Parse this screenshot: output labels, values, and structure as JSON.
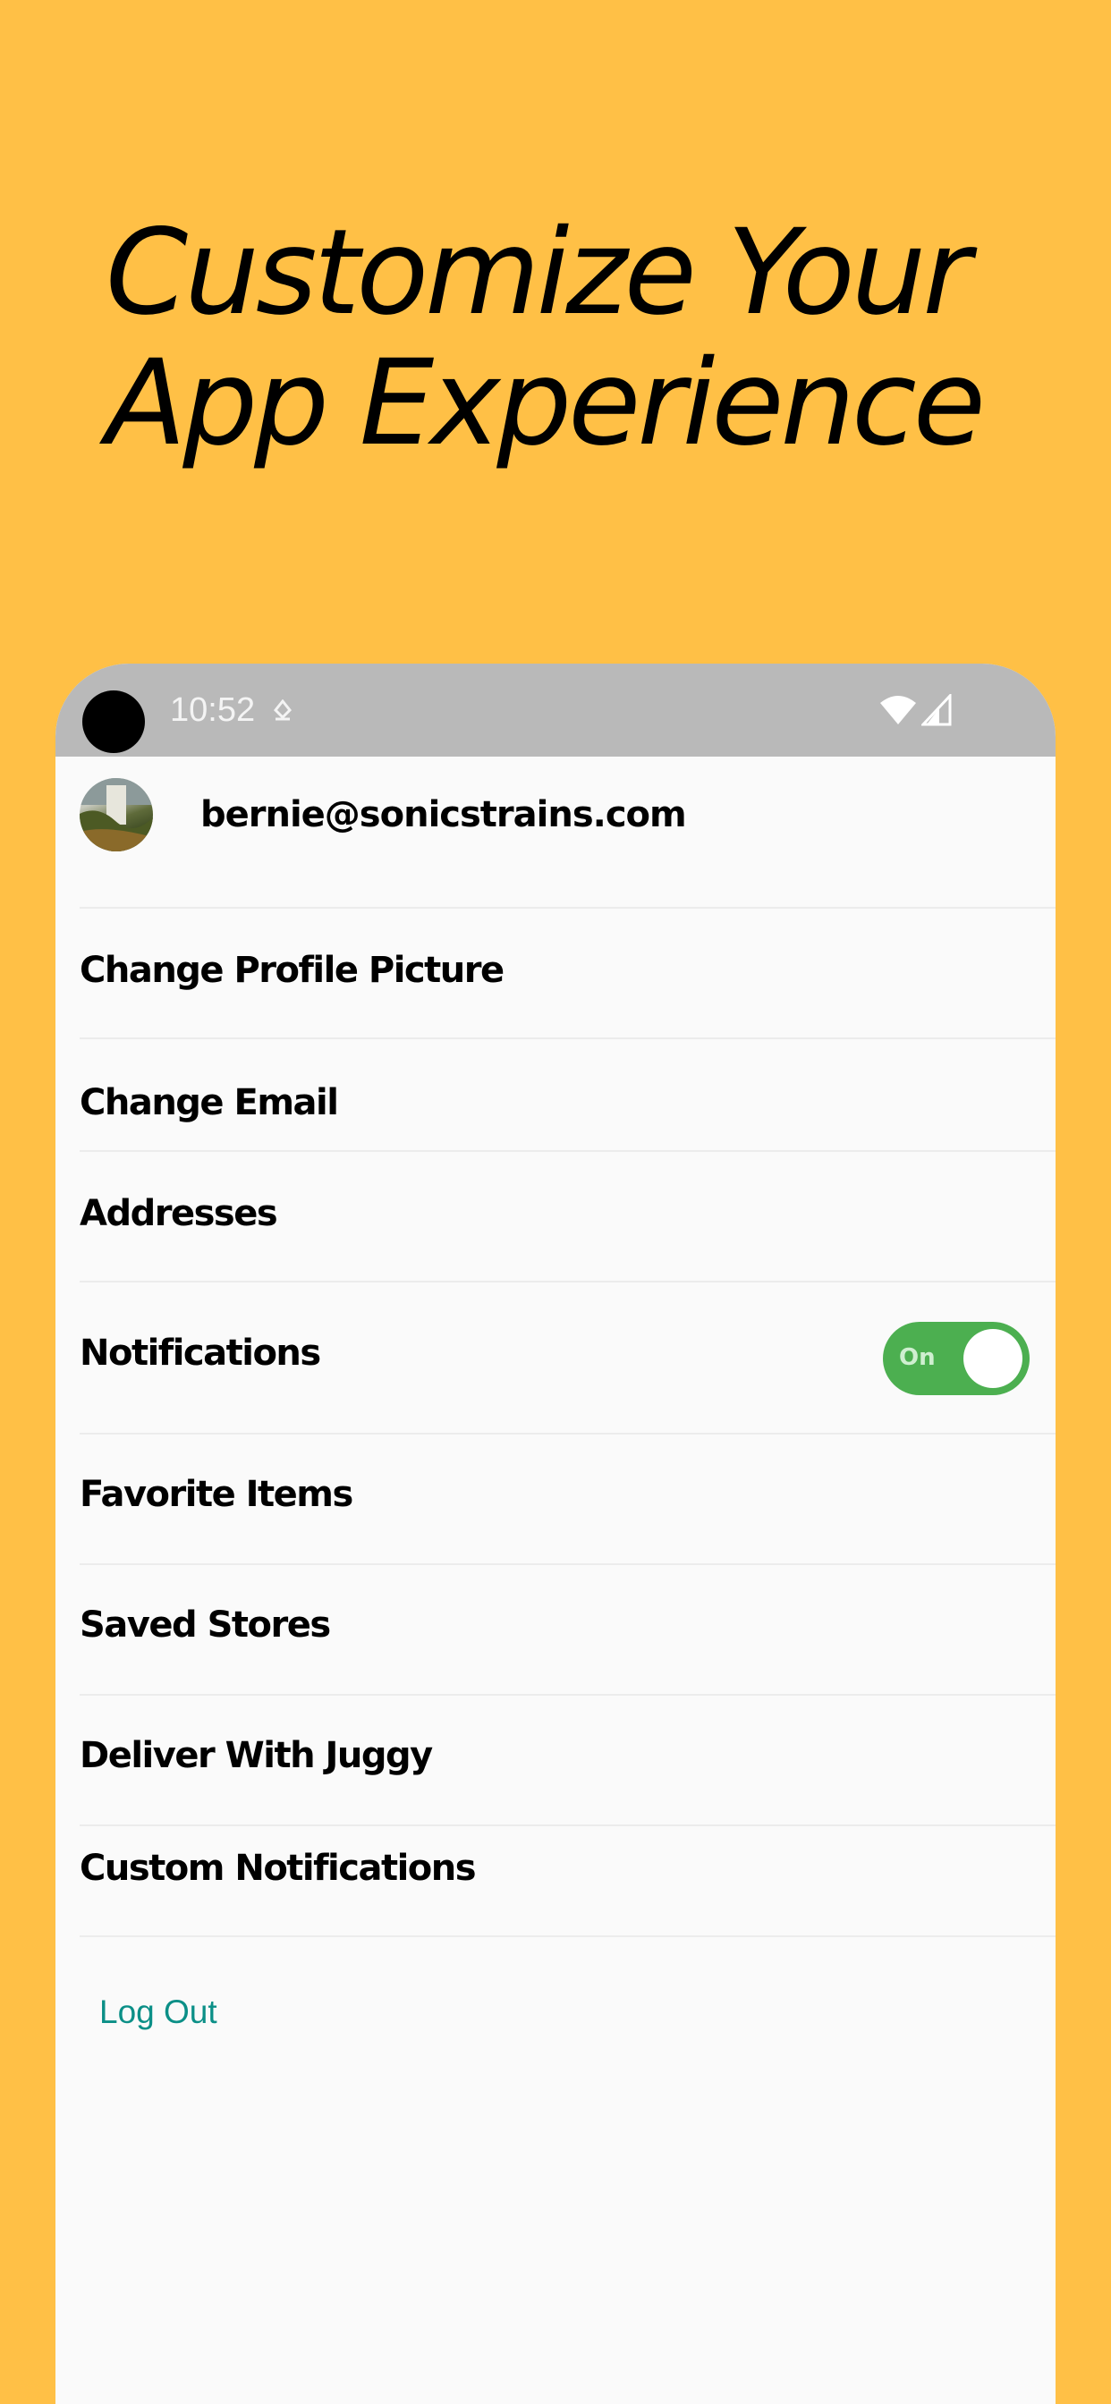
{
  "headline": {
    "line1": "Customize Your",
    "line2": "App Experience"
  },
  "status_bar": {
    "time": "10:52",
    "icons": [
      "notification-icon",
      "wifi-icon",
      "signal-icon"
    ]
  },
  "account": {
    "email": "bernie@sonicstrains.com",
    "avatar": "avatar-photo"
  },
  "menu": {
    "items": [
      {
        "label": "Change Profile Picture"
      },
      {
        "label": "Change Email"
      },
      {
        "label": "Addresses"
      },
      {
        "label": "Notifications",
        "toggle": {
          "text": "On",
          "state": true
        }
      },
      {
        "label": "Favorite Items"
      },
      {
        "label": "Saved Stores"
      },
      {
        "label": "Deliver With Juggy"
      },
      {
        "label": "Custom Notifications"
      }
    ]
  },
  "logout_label": "Log Out",
  "colors": {
    "background": "#FFC046",
    "status_bar": "#B9B9B9",
    "toggle_on": "#4CAF50",
    "logout": "#0B8F87"
  }
}
